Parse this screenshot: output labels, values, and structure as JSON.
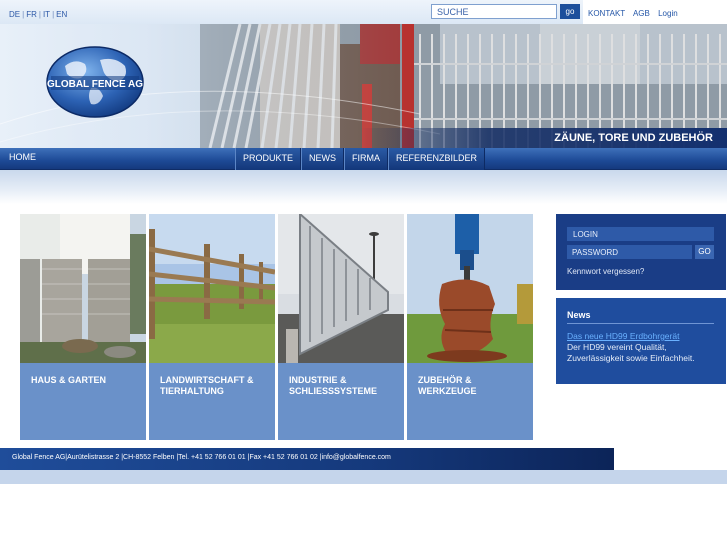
{
  "languages": [
    "DE",
    "FR",
    "IT",
    "EN"
  ],
  "search": {
    "placeholder": "SUCHE",
    "go_label": "go"
  },
  "top_links": [
    "KONTAKT",
    "AGB",
    "Login"
  ],
  "logo": {
    "text": "GLOBAL FENCE AG"
  },
  "header": {
    "slogan": "ZÄUNE, TORE UND ZUBEHÖR"
  },
  "nav": {
    "home": "HOME",
    "items": [
      "PRODUKTE",
      "NEWS",
      "FIRMA",
      "REFERENZBILDER"
    ]
  },
  "categories": [
    {
      "line1": "HAUS & GARTEN",
      "line2": ""
    },
    {
      "line1": "LANDWIRTSCHAFT &",
      "line2": "TIERHALTUNG"
    },
    {
      "line1": "INDUSTRIE &",
      "line2": "SCHLIESSSYSTEME"
    },
    {
      "line1": "ZUBEHÖR &",
      "line2": "WERKZEUGE"
    }
  ],
  "login": {
    "login_placeholder": "LOGIN",
    "password_placeholder": "PASSWORD",
    "go_label": "GO",
    "forgot": "Kennwort vergessen?"
  },
  "news": {
    "title": "News",
    "link": "Das neue HD99 Erdbohrgerät",
    "text": "Der HD99 vereint Qualität, Zuverlässigkeit sowie Einfachheit."
  },
  "footer": {
    "text": "Global Fence AG|Aurütelistrasse 2 |CH-8552 Felben |Tel. +41 52 766 01 01 |Fax +41 52 766 01 02 |info@globalfence.com"
  },
  "colors": {
    "brand_dark": "#13306f",
    "brand": "#1d4a96",
    "tile": "#6a91c9",
    "news_link": "#6ab1ff"
  }
}
